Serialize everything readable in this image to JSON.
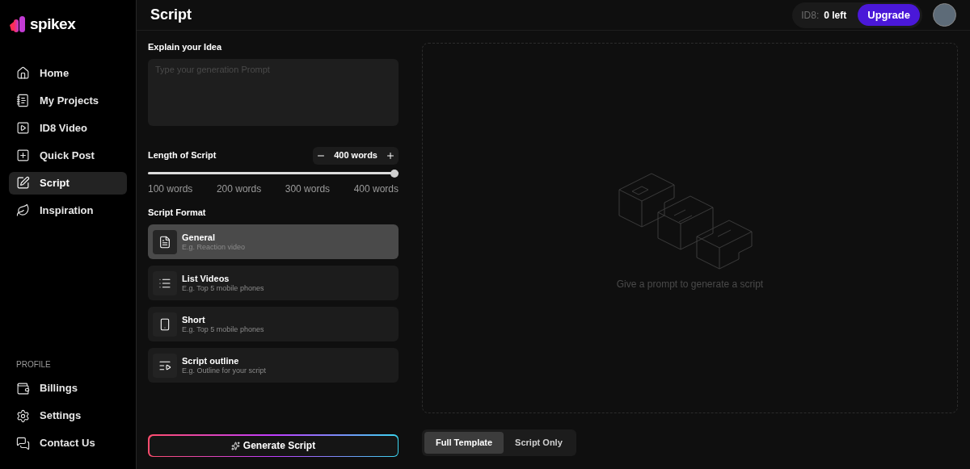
{
  "brand": {
    "name": "spikex"
  },
  "sidebar": {
    "items": [
      {
        "label": "Home",
        "selected": false
      },
      {
        "label": "My Projects",
        "selected": false
      },
      {
        "label": "ID8 Video",
        "selected": false
      },
      {
        "label": "Quick Post",
        "selected": false
      },
      {
        "label": "Script",
        "selected": true
      },
      {
        "label": "Inspiration",
        "selected": false
      }
    ],
    "profile_heading": "PROFILE",
    "profile_items": [
      {
        "label": "Billings",
        "selected": false
      },
      {
        "label": "Settings",
        "selected": false
      },
      {
        "label": "Contact Us",
        "selected": false
      }
    ]
  },
  "header": {
    "title": "Script",
    "credits_label": "ID8:",
    "credits_value": "0 left",
    "upgrade": "Upgrade"
  },
  "idea": {
    "label": "Explain your Idea",
    "placeholder": "Type your generation Prompt"
  },
  "length": {
    "label": "Length of Script",
    "value": "400 words",
    "level": 1,
    "ticks": [
      "100 words",
      "200 words",
      "300 words",
      "400 words"
    ]
  },
  "format": {
    "label": "Script Format",
    "options": [
      {
        "title": "General",
        "subtitle": "E.g. Reaction video",
        "selected": true
      },
      {
        "title": "List Videos",
        "subtitle": "E.g. Top 5 mobile phones",
        "selected": false
      },
      {
        "title": "Short",
        "subtitle": "E.g. Top 5 mobile phones",
        "selected": false
      },
      {
        "title": "Script outline",
        "subtitle": "E.g. Outline for your script",
        "selected": false
      }
    ]
  },
  "generate_button": "Generate Script",
  "preview": {
    "empty_text": "Give a prompt to generate a script"
  },
  "view_tabs": [
    {
      "label": "Full Template",
      "selected": true
    },
    {
      "label": "Script Only",
      "selected": false
    }
  ]
}
